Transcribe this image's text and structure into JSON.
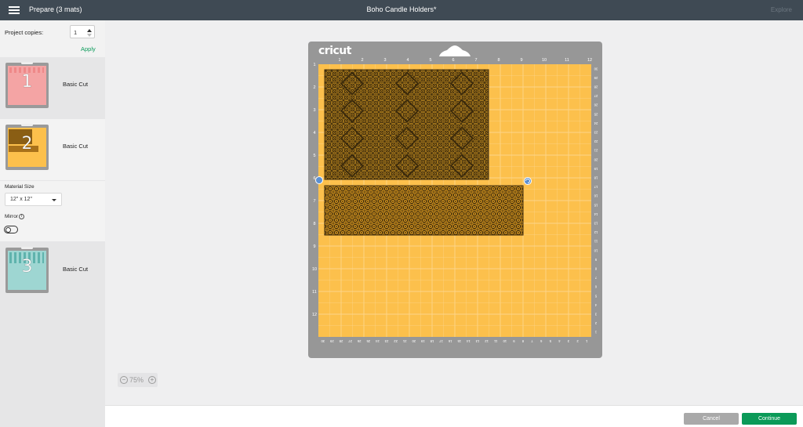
{
  "topbar": {
    "title": "Prepare (3 mats)",
    "project_name": "Boho Candle Holders*",
    "explore": "Explore"
  },
  "sidebar": {
    "copies_label": "Project copies:",
    "copies_value": "1",
    "apply_label": "Apply",
    "mats": [
      {
        "number": "1",
        "label": "Basic Cut",
        "color": "#f4a4a4"
      },
      {
        "number": "2",
        "label": "Basic Cut",
        "color": "#fcc04c"
      },
      {
        "number": "3",
        "label": "Basic Cut",
        "color": "#9ed6d2"
      }
    ],
    "material_size_label": "Material Size",
    "material_size_value": "12\" x 12\"",
    "mirror_label": "Mirror",
    "mirror_on": false
  },
  "canvas": {
    "brand": "cricut",
    "mat_color": "#fcc04c",
    "pattern_color": "#3b2a0c",
    "top_ruler": [
      "1",
      "2",
      "3",
      "4",
      "5",
      "6",
      "7",
      "8",
      "9",
      "10",
      "11",
      "12"
    ],
    "left_ruler": [
      "1",
      "2",
      "3",
      "4",
      "5",
      "6",
      "7",
      "8",
      "9",
      "10",
      "11",
      "12"
    ],
    "bottom_ruler": [
      "30",
      "29",
      "28",
      "27",
      "26",
      "25",
      "24",
      "23",
      "22",
      "21",
      "20",
      "19",
      "18",
      "17",
      "16",
      "15",
      "14",
      "13",
      "12",
      "11",
      "10",
      "9",
      "8",
      "7",
      "6",
      "5",
      "4",
      "3",
      "2",
      "1"
    ],
    "right_ruler": [
      "30",
      "29",
      "28",
      "27",
      "26",
      "25",
      "24",
      "23",
      "22",
      "21",
      "20",
      "19",
      "18",
      "17",
      "16",
      "15",
      "14",
      "13",
      "12",
      "11",
      "10",
      "9",
      "8",
      "7",
      "6",
      "5",
      "4",
      "3",
      "2",
      "1"
    ]
  },
  "zoom": {
    "minus": "−",
    "value": "75%",
    "plus": "+"
  },
  "footer": {
    "cancel_label": "Cancel",
    "continue_label": "Continue"
  }
}
